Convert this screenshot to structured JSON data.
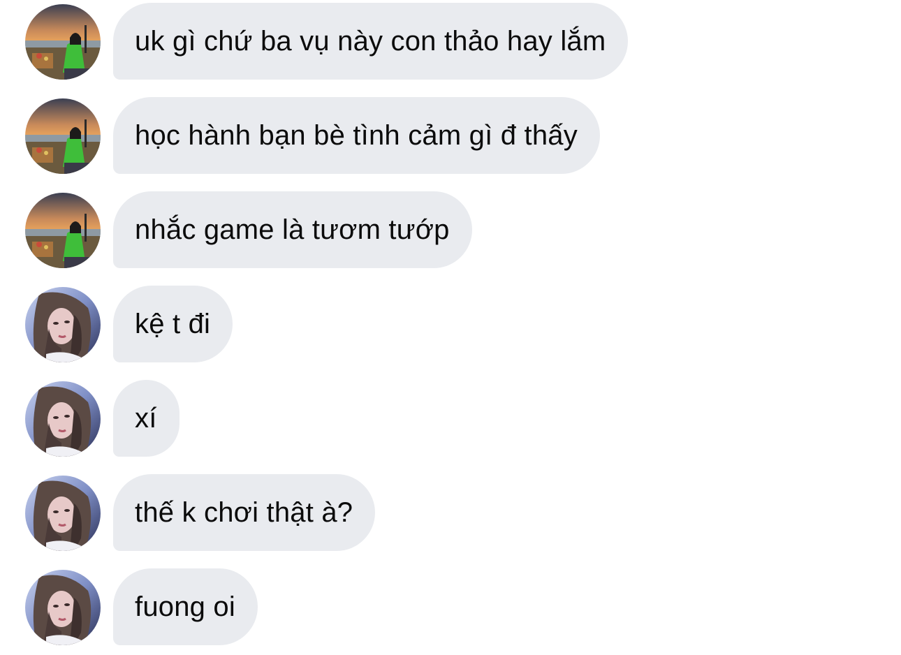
{
  "conversation": {
    "messages": [
      {
        "sender": "sender-a",
        "avatar_icon": "profile-photo-sunset-icon",
        "text": "uk gì chứ ba vụ này con thảo hay lắm"
      },
      {
        "sender": "sender-a",
        "avatar_icon": "profile-photo-sunset-icon",
        "text": "học hành bạn bè tình cảm gì đ thấy"
      },
      {
        "sender": "sender-a",
        "avatar_icon": "profile-photo-sunset-icon",
        "text": "nhắc game là tươm tướp"
      },
      {
        "sender": "sender-b",
        "avatar_icon": "profile-photo-portrait-icon",
        "text": "kệ t đi"
      },
      {
        "sender": "sender-b",
        "avatar_icon": "profile-photo-portrait-icon",
        "text": "xí"
      },
      {
        "sender": "sender-b",
        "avatar_icon": "profile-photo-portrait-icon",
        "text": "thế k chơi thật à?"
      },
      {
        "sender": "sender-b",
        "avatar_icon": "profile-photo-portrait-icon",
        "text": "fuong oi"
      }
    ]
  },
  "colors": {
    "background": "#ffffff",
    "bubble": "#e9ebef",
    "text": "#0b0b0b"
  }
}
